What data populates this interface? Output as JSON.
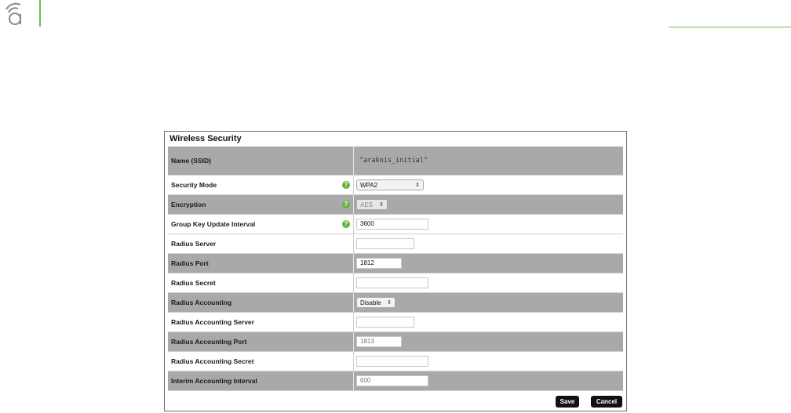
{
  "header": {
    "logo_icon": "wifi-a-logo-icon",
    "accent_color": "#6cc04a"
  },
  "panel": {
    "title": "Wireless Security",
    "rows": {
      "ssid_label": "Name (SSID)",
      "ssid_value": "\"araknis_initial\"",
      "security_mode_label": "Security Mode",
      "security_mode_value": "WPA2",
      "encryption_label": "Encryption",
      "encryption_value": "AES",
      "group_key_label": "Group Key Update Interval",
      "group_key_value": "3600",
      "radius_server_label": "Radius Server",
      "radius_server_value": "",
      "radius_port_label": "Radius Port",
      "radius_port_value": "1812",
      "radius_secret_label": "Radius Secret",
      "radius_secret_value": "",
      "radius_accounting_label": "Radius Accounting",
      "radius_accounting_value": "Disable",
      "radius_acct_server_label": "Radius Accounting Server",
      "radius_acct_server_value": "",
      "radius_acct_port_label": "Radius Accounting Port",
      "radius_acct_port_value": "1813",
      "radius_acct_secret_label": "Radius Accounting Secret",
      "radius_acct_secret_value": "",
      "interim_label": "Interim Accounting Interval",
      "interim_value": "600"
    },
    "buttons": {
      "save": "Save",
      "cancel": "Cancel"
    },
    "help_icon": "help-circle-icon"
  }
}
